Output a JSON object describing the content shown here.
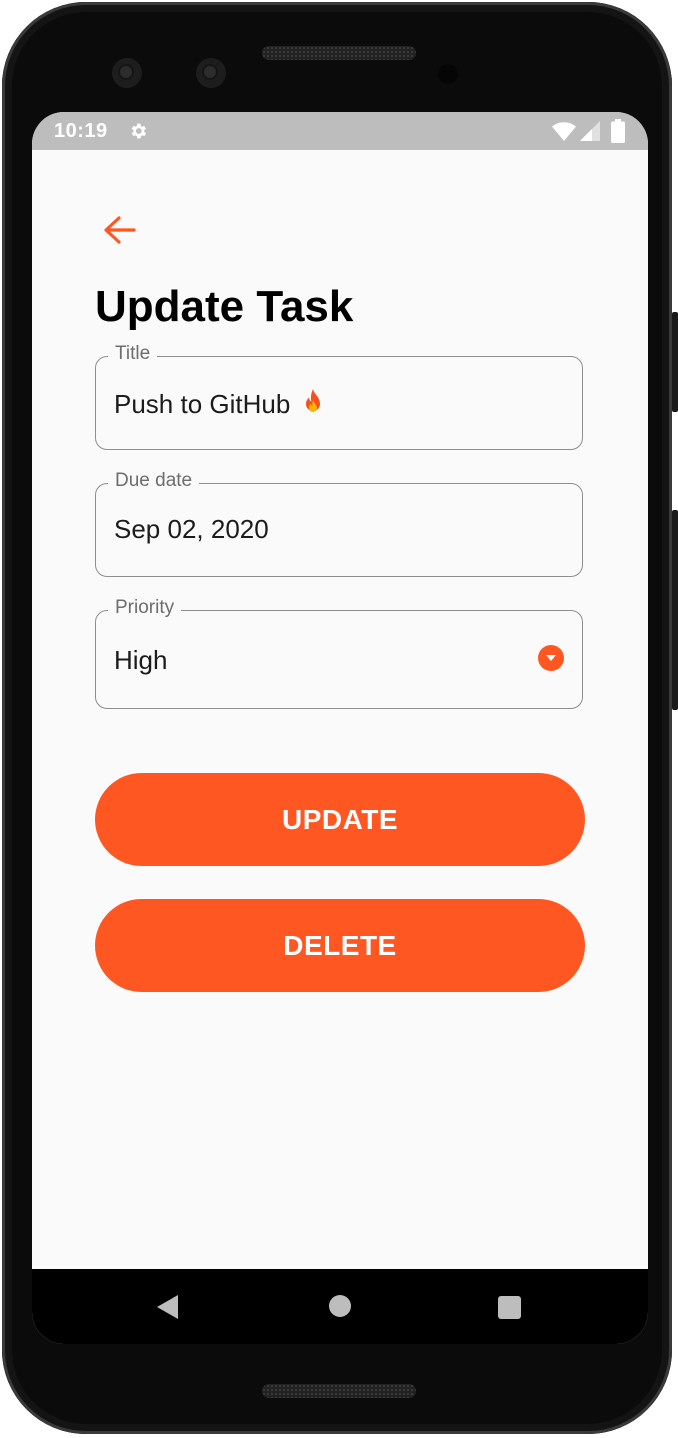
{
  "status_bar": {
    "time": "10:19",
    "icons": [
      "gear-icon",
      "wifi-icon",
      "signal-icon",
      "battery-icon"
    ]
  },
  "header": {
    "back_icon": "arrow-left-icon",
    "title": "Update Task"
  },
  "form": {
    "title_field": {
      "label": "Title",
      "value": "Push to GitHub",
      "emoji": "fire-emoji"
    },
    "due_date_field": {
      "label": "Due date",
      "value": "Sep 02, 2020"
    },
    "priority_field": {
      "label": "Priority",
      "value": "High",
      "icon": "dropdown-arrow-icon"
    }
  },
  "actions": {
    "update_label": "UPDATE",
    "delete_label": "DELETE"
  },
  "nav_bar": {
    "icons": [
      "nav-back-icon",
      "nav-home-icon",
      "nav-recents-icon"
    ]
  },
  "colors": {
    "accent": "#FF5722",
    "background": "#FAFAFA",
    "status_bar": "#BDBDBD",
    "outline": "#8E8E8E"
  }
}
